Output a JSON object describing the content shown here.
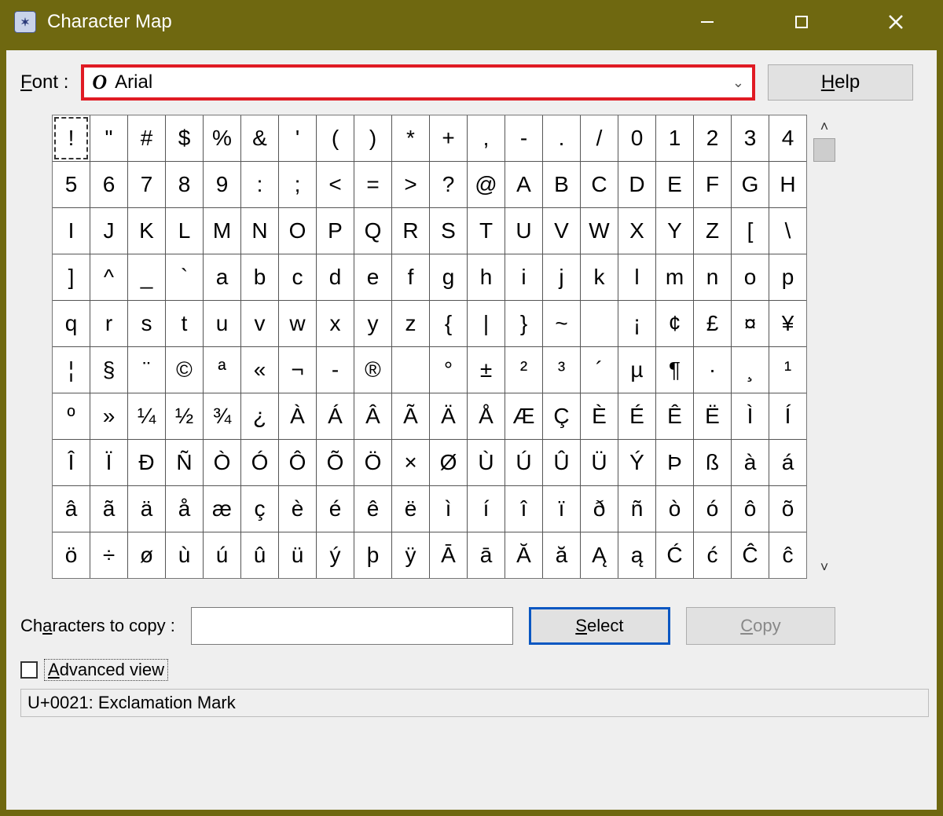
{
  "window": {
    "title": "Character Map"
  },
  "fontrow": {
    "label_pre": "F",
    "label_rest": "ont :",
    "selected_font": "Arial"
  },
  "help": {
    "label_pre": "H",
    "label_rest": "elp"
  },
  "grid": {
    "cols": 20,
    "selected_index": 0,
    "chars": [
      "!",
      "\"",
      "#",
      "$",
      "%",
      "&",
      "'",
      "(",
      ")",
      "*",
      "+",
      ",",
      "-",
      ".",
      "/",
      "0",
      "1",
      "2",
      "3",
      "4",
      "5",
      "6",
      "7",
      "8",
      "9",
      ":",
      ";",
      "<",
      "=",
      ">",
      "?",
      "@",
      "A",
      "B",
      "C",
      "D",
      "E",
      "F",
      "G",
      "H",
      "I",
      "J",
      "K",
      "L",
      "M",
      "N",
      "O",
      "P",
      "Q",
      "R",
      "S",
      "T",
      "U",
      "V",
      "W",
      "X",
      "Y",
      "Z",
      "[",
      "\\",
      "]",
      "^",
      "_",
      "`",
      "a",
      "b",
      "c",
      "d",
      "e",
      "f",
      "g",
      "h",
      "i",
      "j",
      "k",
      "l",
      "m",
      "n",
      "o",
      "p",
      "q",
      "r",
      "s",
      "t",
      "u",
      "v",
      "w",
      "x",
      "y",
      "z",
      "{",
      "|",
      "}",
      "~",
      " ",
      "¡",
      "¢",
      "£",
      "¤",
      "¥",
      "¦",
      "§",
      "¨",
      "©",
      "ª",
      "«",
      "¬",
      "-",
      "®",
      " ",
      "°",
      "±",
      "²",
      "³",
      "´",
      "µ",
      "¶",
      "·",
      "¸",
      "¹",
      "º",
      "»",
      "¼",
      "½",
      "¾",
      "¿",
      "À",
      "Á",
      "Â",
      "Ã",
      "Ä",
      "Å",
      "Æ",
      "Ç",
      "È",
      "É",
      "Ê",
      "Ë",
      "Ì",
      "Í",
      "Î",
      "Ï",
      "Ð",
      "Ñ",
      "Ò",
      "Ó",
      "Ô",
      "Õ",
      "Ö",
      "×",
      "Ø",
      "Ù",
      "Ú",
      "Û",
      "Ü",
      "Ý",
      "Þ",
      "ß",
      "à",
      "á",
      "â",
      "ã",
      "ä",
      "å",
      "æ",
      "ç",
      "è",
      "é",
      "ê",
      "ë",
      "ì",
      "í",
      "î",
      "ï",
      "ð",
      "ñ",
      "ò",
      "ó",
      "ô",
      "õ",
      "ö",
      "÷",
      "ø",
      "ù",
      "ú",
      "û",
      "ü",
      "ý",
      "þ",
      "ÿ",
      "Ā",
      "ā",
      "Ă",
      "ă",
      "Ą",
      "ą",
      "Ć",
      "ć",
      "Ĉ",
      "ĉ"
    ]
  },
  "copy_row": {
    "label_pre": "Ch",
    "label_ul": "a",
    "label_rest": "racters to copy :",
    "value": "",
    "select_pre": "S",
    "select_rest": "elect",
    "copy_pre": "C",
    "copy_rest": "opy"
  },
  "advanced": {
    "label_pre": "A",
    "label_rest": "dvanced view",
    "checked": false
  },
  "status": "U+0021: Exclamation Mark"
}
